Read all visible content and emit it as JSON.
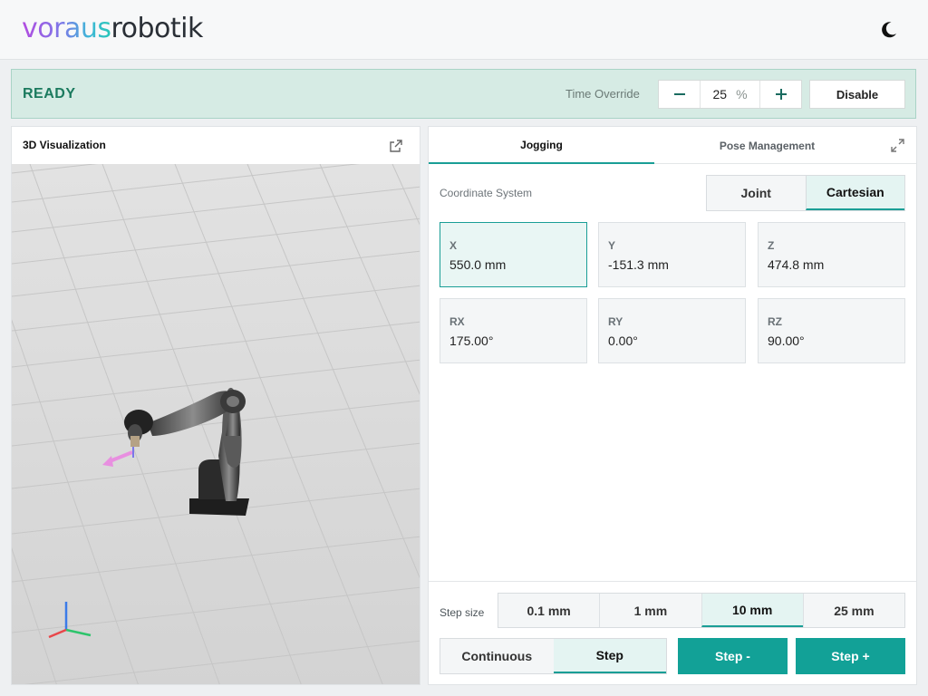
{
  "header": {
    "logo_part1": "voraus",
    "logo_part2": "robotik",
    "theme_toggle_icon": "moon-icon"
  },
  "status": {
    "state": "READY",
    "time_override_label": "Time Override",
    "time_override_value": "25",
    "time_override_unit": "%",
    "disable_label": "Disable",
    "accent": "#1b7a5e"
  },
  "visualization": {
    "title": "3D Visualization",
    "open_external_icon": "external-link-icon"
  },
  "jogging": {
    "tabs": [
      {
        "label": "Jogging",
        "active": true
      },
      {
        "label": "Pose Management",
        "active": false
      }
    ],
    "expand_icon": "expand-icon",
    "coordinate_system_label": "Coordinate System",
    "coordinate_systems": [
      {
        "label": "Joint",
        "active": false
      },
      {
        "label": "Cartesian",
        "active": true
      }
    ],
    "coordinates": [
      {
        "label": "X",
        "value": "550.0 mm",
        "active": true
      },
      {
        "label": "Y",
        "value": "-151.3 mm",
        "active": false
      },
      {
        "label": "Z",
        "value": "474.8 mm",
        "active": false
      },
      {
        "label": "RX",
        "value": "175.00°",
        "active": false
      },
      {
        "label": "RY",
        "value": "0.00°",
        "active": false
      },
      {
        "label": "RZ",
        "value": "90.00°",
        "active": false
      }
    ],
    "step_size_label": "Step size",
    "step_sizes": [
      {
        "label": "0.1 mm",
        "active": false
      },
      {
        "label": "1 mm",
        "active": false
      },
      {
        "label": "10 mm",
        "active": true
      },
      {
        "label": "25 mm",
        "active": false
      }
    ],
    "modes": [
      {
        "label": "Continuous",
        "active": false
      },
      {
        "label": "Step",
        "active": true
      }
    ],
    "step_minus_label": "Step -",
    "step_plus_label": "Step +",
    "accent": "#12a197"
  }
}
